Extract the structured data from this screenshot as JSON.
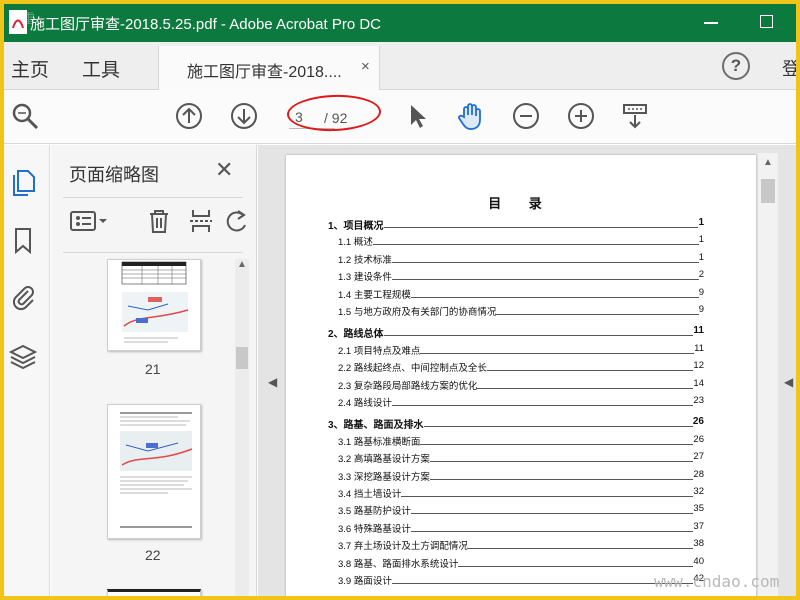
{
  "window": {
    "title": "施工图厅审查-2018.5.25.pdf - Adobe Acrobat Pro DC",
    "corner_watermark": "雷"
  },
  "tabs": {
    "home": "主页",
    "tools": "工具",
    "document_tab": "施工图厅审查-2018....",
    "close_glyph": "×",
    "help": "?",
    "login_partial": "登"
  },
  "toolbar": {
    "current_page": "3",
    "page_total": "/ 92",
    "icons": [
      "zoom-search-icon",
      "page-up-icon",
      "page-down-icon",
      "select-cursor-icon",
      "hand-icon",
      "zoom-out-icon",
      "zoom-in-icon",
      "page-display-icon"
    ]
  },
  "thumbnail_panel": {
    "title": "页面缩略图",
    "close_glyph": "✕",
    "pages": [
      {
        "label": "21"
      },
      {
        "label": "22"
      }
    ]
  },
  "document": {
    "toc_heading": "目  录",
    "entries": [
      {
        "level": 1,
        "text": "1、项目概况",
        "page": "1"
      },
      {
        "level": 2,
        "text": "1.1 概述",
        "page": "1"
      },
      {
        "level": 2,
        "text": "1.2 技术标准",
        "page": "1"
      },
      {
        "level": 2,
        "text": "1.3 建设条件",
        "page": "2"
      },
      {
        "level": 2,
        "text": "1.4 主要工程规模",
        "page": "9"
      },
      {
        "level": 2,
        "text": "1.5 与地方政府及有关部门的协商情况",
        "page": "9"
      },
      {
        "level": 1,
        "text": "2、路线总体",
        "page": "11"
      },
      {
        "level": 2,
        "text": "2.1 项目特点及难点",
        "page": "11"
      },
      {
        "level": 2,
        "text": "2.2 路线起终点、中间控制点及全长",
        "page": "12"
      },
      {
        "level": 2,
        "text": "2.3 复杂路段局部路线方案的优化",
        "page": "14"
      },
      {
        "level": 2,
        "text": "2.4 路线设计",
        "page": "23"
      },
      {
        "level": 1,
        "text": "3、路基、路面及排水",
        "page": "26"
      },
      {
        "level": 2,
        "text": "3.1  路基标准横断面",
        "page": "26"
      },
      {
        "level": 2,
        "text": "3.2 高填路基设计方案",
        "page": "27"
      },
      {
        "level": 2,
        "text": "3.3  深挖路基设计方案",
        "page": "28"
      },
      {
        "level": 2,
        "text": "3.4 挡土墙设计",
        "page": "32"
      },
      {
        "level": 2,
        "text": "3.5 路基防护设计",
        "page": "35"
      },
      {
        "level": 2,
        "text": "3.6 特殊路基设计",
        "page": "37"
      },
      {
        "level": 2,
        "text": "3.7 弃土场设计及土方调配情况",
        "page": "38"
      },
      {
        "level": 2,
        "text": "3.8 路基、路面排水系统设计",
        "page": "40"
      },
      {
        "level": 2,
        "text": "3.9 路面设计",
        "page": "42"
      }
    ]
  },
  "watermark": "www.cndao.com",
  "colors": {
    "titlebar": "#0c7a3e",
    "frame_border": "#f0c419",
    "annotation_oval": "#e01818",
    "icon_blue": "#1f6fd1"
  }
}
